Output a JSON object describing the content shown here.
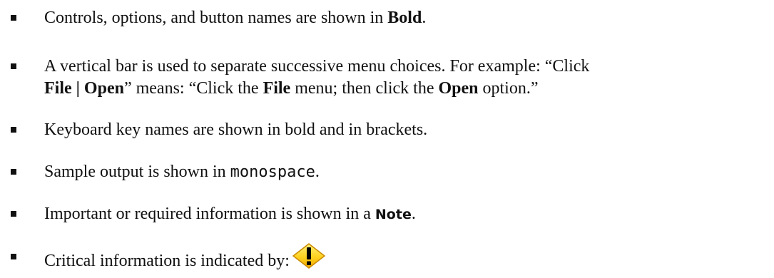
{
  "conventions": {
    "item1": {
      "pre": "Controls, options, and button names are shown in ",
      "bold": "Bold",
      "post": "."
    },
    "item2": {
      "line1": "A vertical bar is used to separate successive menu choices. For example: “Click",
      "l2_b1": "File | Open",
      "l2_t1": "” means: “Click the ",
      "l2_b2": "File",
      "l2_t2": " menu; then click the ",
      "l2_b3": "Open",
      "l2_t3": " option.”"
    },
    "item3": {
      "text": "Keyboard key names are shown in bold and in brackets."
    },
    "item4": {
      "pre": "Sample output is shown in ",
      "mono": "monospace",
      "post": "."
    },
    "item5": {
      "pre": "Important or required information is shown in a ",
      "note": "Note",
      "post": "."
    },
    "item6": {
      "text": "Critical information is indicated by:",
      "icon": "warning-icon"
    }
  },
  "colors": {
    "text": "#111111",
    "warning_fill": "#FFD21F",
    "warning_mark": "#000000"
  }
}
